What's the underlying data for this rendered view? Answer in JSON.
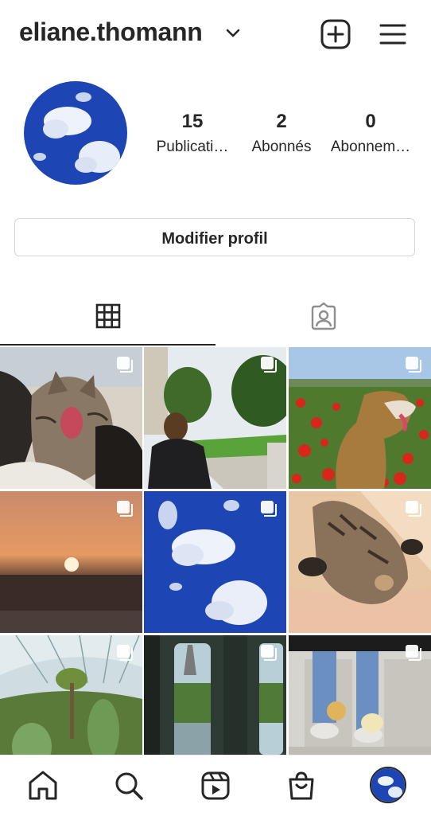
{
  "header": {
    "username": "eliane.thomann",
    "icons": [
      "chevron-down-icon",
      "new-post-icon",
      "menu-icon"
    ]
  },
  "profile": {
    "stats": [
      {
        "value": "15",
        "label": "Publicati…"
      },
      {
        "value": "2",
        "label": "Abonnés"
      },
      {
        "value": "0",
        "label": "Abonnem…"
      }
    ],
    "edit_button": "Modifier profil"
  },
  "tabs": [
    {
      "name": "posts-grid",
      "icon": "grid-icon",
      "selected": true
    },
    {
      "name": "tagged",
      "icon": "tagged-person-icon",
      "selected": false
    }
  ],
  "posts": [
    {
      "subject": "kitten-yawning",
      "multiple": true
    },
    {
      "subject": "park-view",
      "multiple": true
    },
    {
      "subject": "dog-in-poppy-field",
      "multiple": true
    },
    {
      "subject": "sunset",
      "multiple": true
    },
    {
      "subject": "blue-sky-clouds",
      "multiple": true
    },
    {
      "subject": "cat-in-sun",
      "multiple": true
    },
    {
      "subject": "greenhouse-plants",
      "multiple": true
    },
    {
      "subject": "train-window-eiffel-tower",
      "multiple": true
    },
    {
      "subject": "chicks-and-feet",
      "multiple": true
    }
  ],
  "bottom_nav": [
    "home-icon",
    "search-icon",
    "reels-icon",
    "shop-icon",
    "profile-avatar"
  ],
  "colors": {
    "text": "#262626",
    "border": "#d6d6d6",
    "sky_blue": "#1d45b4"
  }
}
